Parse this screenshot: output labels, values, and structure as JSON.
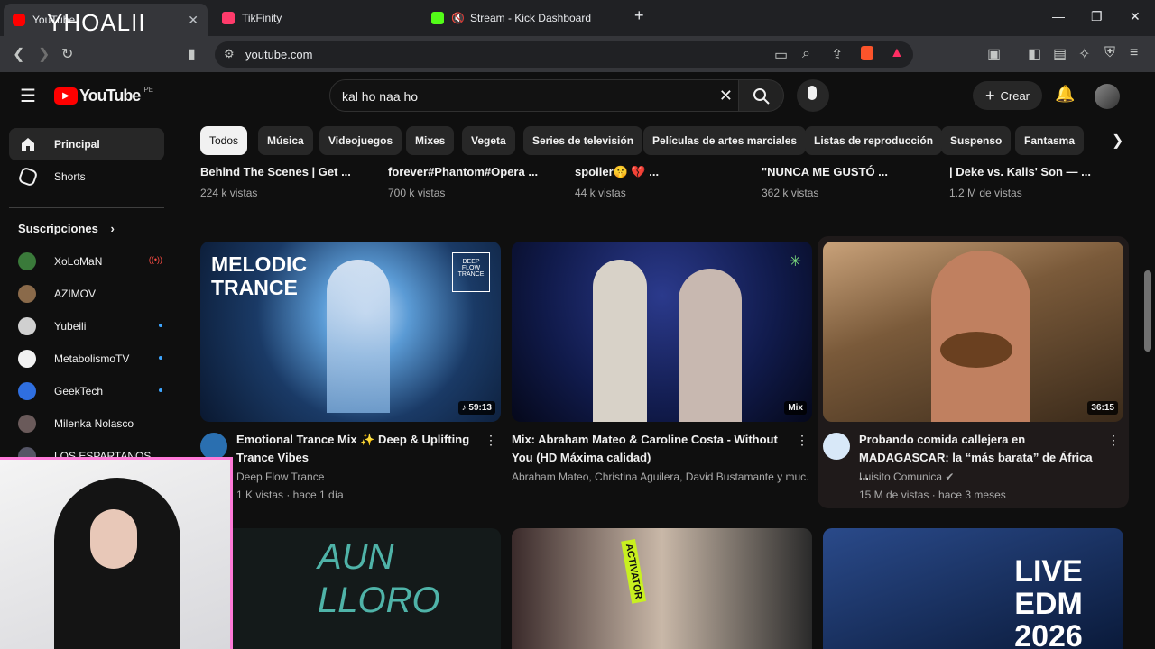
{
  "browser": {
    "tabs": [
      {
        "label": "YouTube",
        "icon": "youtube-favicon",
        "color": "#ff0000"
      },
      {
        "label": "TikFinity",
        "icon": "tikfinity-favicon",
        "color": "#ff3b6b"
      },
      {
        "label": "Stream - Kick Dashboard",
        "icon": "kick-favicon",
        "color": "#53fc18"
      }
    ],
    "overlay_text": "YHOALII",
    "url": "youtube.com"
  },
  "header": {
    "logo": "YouTube",
    "region": "PE",
    "search_value": "kal ho naa ho",
    "create_label": "Crear"
  },
  "sidebar": {
    "items": [
      {
        "label": "Principal",
        "icon": "home-icon"
      },
      {
        "label": "Shorts",
        "icon": "shorts-icon"
      }
    ],
    "subs_heading": "Suscripciones",
    "subs": [
      {
        "name": "XoLoMaN",
        "live": true,
        "color": "#3a7a3a"
      },
      {
        "name": "AZIMOV",
        "live": false,
        "color": "#8a6a4a"
      },
      {
        "name": "Yubeili",
        "live": false,
        "color": "#d0d0d0"
      },
      {
        "name": "MetabolismoTV",
        "live": false,
        "color": "#f2f2f2"
      },
      {
        "name": "GeekTech",
        "live": false,
        "color": "#2f6fe0"
      },
      {
        "name": "Milenka Nolasco",
        "live": false,
        "color": "#6a5a5a"
      },
      {
        "name": "LOS ESPARTANOS",
        "live": false,
        "color": "#556"
      }
    ]
  },
  "chips": [
    "Todos",
    "Música",
    "Videojuegos",
    "Mixes",
    "Vegeta",
    "Series de televisión",
    "Películas de artes marciales",
    "Listas de reproducción",
    "Suspenso",
    "Fantasma"
  ],
  "prev_row": [
    {
      "title": "Behind The Scenes | Get ...",
      "views": "224 k vistas"
    },
    {
      "title": "forever#Phantom#Opera ...",
      "views": "700 k vistas"
    },
    {
      "title": "spoiler🤫 💔 ...",
      "views": "44 k vistas"
    },
    {
      "title": "\"NUNCA ME GUSTÓ ...",
      "views": "362 k vistas"
    },
    {
      "title": "| Deke vs. Kalis' Son — ...",
      "views": "1.2 M de vistas"
    }
  ],
  "videos": [
    {
      "title": "Emotional Trance Mix ✨ Deep & Uplifting Trance Vibes",
      "channel": "Deep Flow Trance",
      "meta": "1 K vistas · hace 1 día",
      "duration": "♪ 59:13",
      "thumb_text": "MELODIC TRANCE",
      "badge": "DEEP FLOW TRANCE"
    },
    {
      "title": "Mix: Abraham Mateo & Caroline Costa - Without You  (HD Máxima calidad)",
      "channel": "Abraham Mateo, Christina Aguilera, David Bustamante y muc...",
      "meta": "",
      "duration": "Mix"
    },
    {
      "title": "Probando comida callejera en MADAGASCAR: la “más barata” de África ...",
      "channel": "Luisito Comunica ✔",
      "meta": "15 M de vistas · hace 3 meses",
      "duration": "36:15"
    }
  ],
  "next_row": [
    {
      "thumb_text": "AUN LLORO"
    },
    {
      "thumb_text": "ACTIVATOR"
    },
    {
      "thumb_text": "LIVE EDM 2026"
    }
  ]
}
